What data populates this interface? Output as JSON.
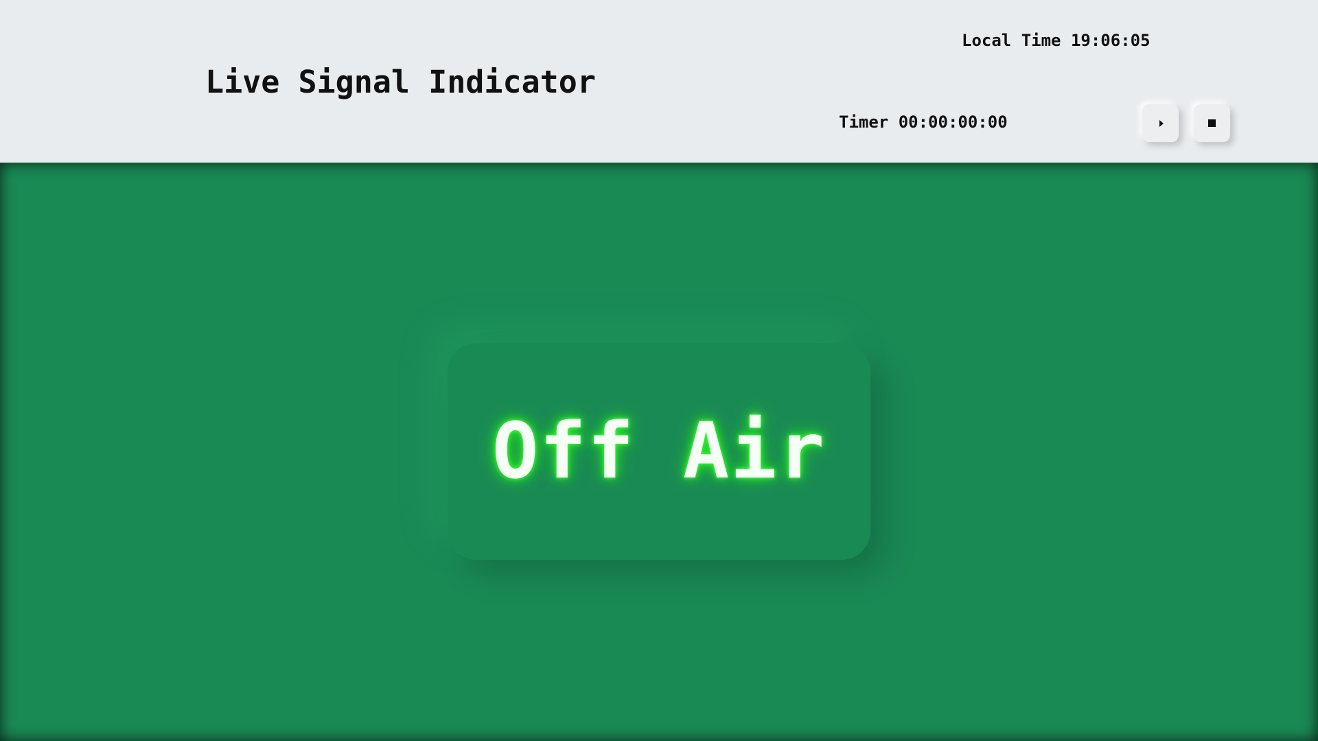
{
  "header": {
    "title": "Live Signal Indicator",
    "local_time": "Local Time 19:06:05",
    "timer": "Timer 00:00:00:00",
    "controls": {
      "play_icon": "play-icon",
      "stop_icon": "stop-icon"
    }
  },
  "signal": {
    "status_text": "Off Air",
    "background_color": "#1a8a55",
    "glow_color": "#2cf02c"
  }
}
